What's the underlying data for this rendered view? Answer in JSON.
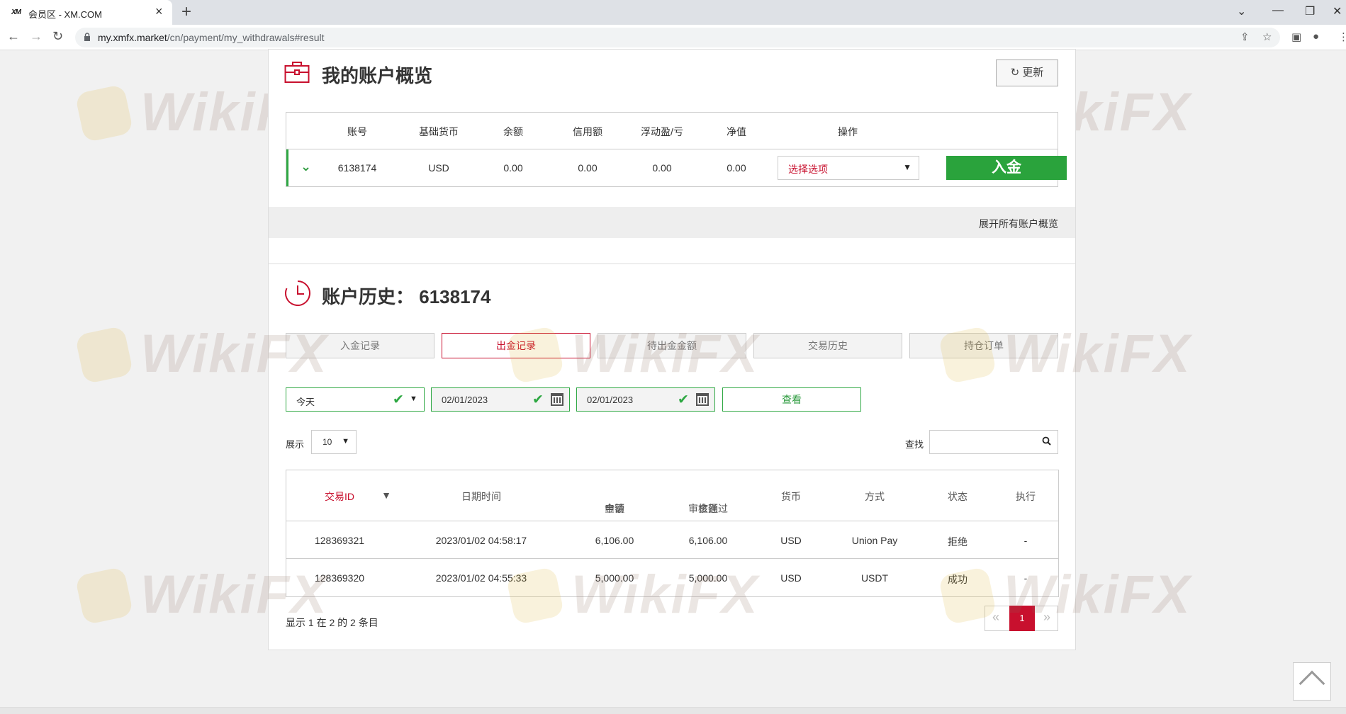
{
  "browser": {
    "tab_title": "会员区 - XM.COM",
    "favicon_text": "XM",
    "url_domain": "my.xmfx.market",
    "url_path": "/cn/payment/my_withdrawals#result"
  },
  "overview": {
    "title": "我的账户概览",
    "refresh_label": "更新",
    "columns": [
      "账号",
      "基础货币",
      "余额",
      "信用额",
      "浮动盈/亏",
      "净值",
      "操作"
    ],
    "row": {
      "account": "6138174",
      "currency": "USD",
      "balance": "0.00",
      "credit": "0.00",
      "floating_pl": "0.00",
      "equity": "0.00",
      "select_value": "选择选项",
      "deposit_label": "入金"
    },
    "expand_label": "展开所有账户概览"
  },
  "history": {
    "title": "账户历史：",
    "account": "6138174",
    "tabs": [
      "入金记录",
      "出金记录",
      "待出金金额",
      "交易历史",
      "持仓订单"
    ],
    "active_tab": "出金记录",
    "filter_period": "今天",
    "date_from": "02/01/2023",
    "date_to": "02/01/2023",
    "view_label": "查看",
    "show_label": "展示",
    "page_size": "10",
    "search_label": "查找",
    "columns": {
      "id": "交易ID",
      "datetime": "日期时间",
      "req_amount_1": "申请",
      "req_amount_2": "金额",
      "approved_1": "审核通过",
      "approved_2": "金额",
      "currency": "货币",
      "method": "方式",
      "status": "状态",
      "action": "执行"
    },
    "rows": [
      {
        "id": "128369321",
        "datetime": "2023/01/02 04:58:17",
        "requested": "6,106.00",
        "approved": "6,106.00",
        "currency": "USD",
        "method": "Union Pay",
        "status": "拒绝",
        "action": "-"
      },
      {
        "id": "128369320",
        "datetime": "2023/01/02 04:55:33",
        "requested": "5,000.00",
        "approved": "5,000.00",
        "currency": "USD",
        "method": "USDT",
        "status": "成功",
        "action": "-"
      }
    ],
    "info_text": "显示 1 在 2 的 2 条目",
    "current_page": "1"
  },
  "watermark": "WikiFX",
  "colors": {
    "accent_red": "#c8102e",
    "accent_green": "#2aa33c"
  }
}
